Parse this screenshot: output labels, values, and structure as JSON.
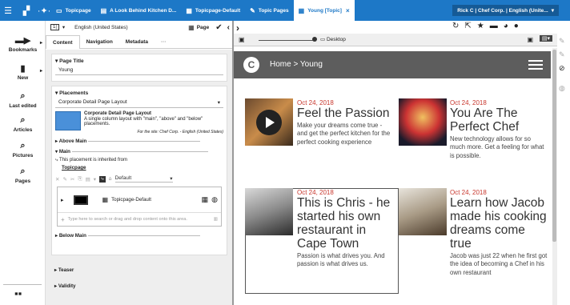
{
  "topbar": {
    "tabs": [
      {
        "icon": "home-icon",
        "label": "Topicpage"
      },
      {
        "icon": "document-icon",
        "label": "A Look Behind Kitchen D..."
      },
      {
        "icon": "page-grid-icon",
        "label": "Topicpage-Default"
      },
      {
        "icon": "topics-icon",
        "label": "Topic Pages"
      },
      {
        "icon": "page-grid-icon",
        "label": "Young [Topic]",
        "close": "×"
      }
    ],
    "user": "Rick C | Chef Corp. | English (Unite...",
    "accent": "#1d78c7"
  },
  "leftnav": {
    "items": [
      {
        "icon": "bookmarks-icon",
        "label": "Bookmarks"
      },
      {
        "icon": "new-icon",
        "label": "New"
      },
      {
        "icon": "last-edited-icon",
        "label": "Last edited"
      },
      {
        "icon": "articles-icon",
        "label": "Articles"
      },
      {
        "icon": "pictures-icon",
        "label": "Pictures"
      },
      {
        "icon": "pages-icon",
        "label": "Pages"
      }
    ]
  },
  "toolbar": {
    "locale": "English (United States)",
    "type": "Page"
  },
  "panel_tabs": [
    "Content",
    "Navigation",
    "Metadata",
    "···"
  ],
  "form": {
    "page_title_label": "Page Title",
    "page_title_value": "Young",
    "placements_label": "Placements",
    "layout_select": "Corporate Detail Page Layout",
    "layout_name": "Corporate Detail Page Layout",
    "layout_desc": "A single column layout with \"main\", \"above\" and \"below\" placements.",
    "layout_site": "For the site: Chef Corp. - English (United States)",
    "above_main": "Above Main",
    "main": "Main",
    "inherited": "This placement is inherited from",
    "inherited_link": "Topicpage",
    "default_select": "Default",
    "item_name": "Topicpage-Default",
    "drop_hint": "Type here to search or drag and drop content onto this area.",
    "below_main": "Below Main",
    "teaser": "Teaser",
    "validity": "Validity"
  },
  "browser": {
    "device": "Desktop"
  },
  "site": {
    "logo": "C",
    "breadcrumb": "Home > Young",
    "teasers": [
      {
        "date": "Oct 24, 2018",
        "title": "Feel the Passion",
        "text": "Make your dreams come true - and get the perfect kitchen for the perfect cooking experience"
      },
      {
        "date": "Oct 24, 2018",
        "title": "You Are The Perfect Chef",
        "text": "New technology allows for so much more. Get a feeling for what is possible."
      },
      {
        "date": "Oct 24, 2018",
        "title": "This is Chris - he started his own restaurant in Cape Town",
        "text": "Passion is what drives you. And passion is what drives us."
      },
      {
        "date": "Oct 24, 2018",
        "title": "Learn how Jacob made his cooking dreams come true",
        "text": "Jacob was just 22 when he first got the idea of becoming a Chef in his own restaurant"
      }
    ]
  }
}
